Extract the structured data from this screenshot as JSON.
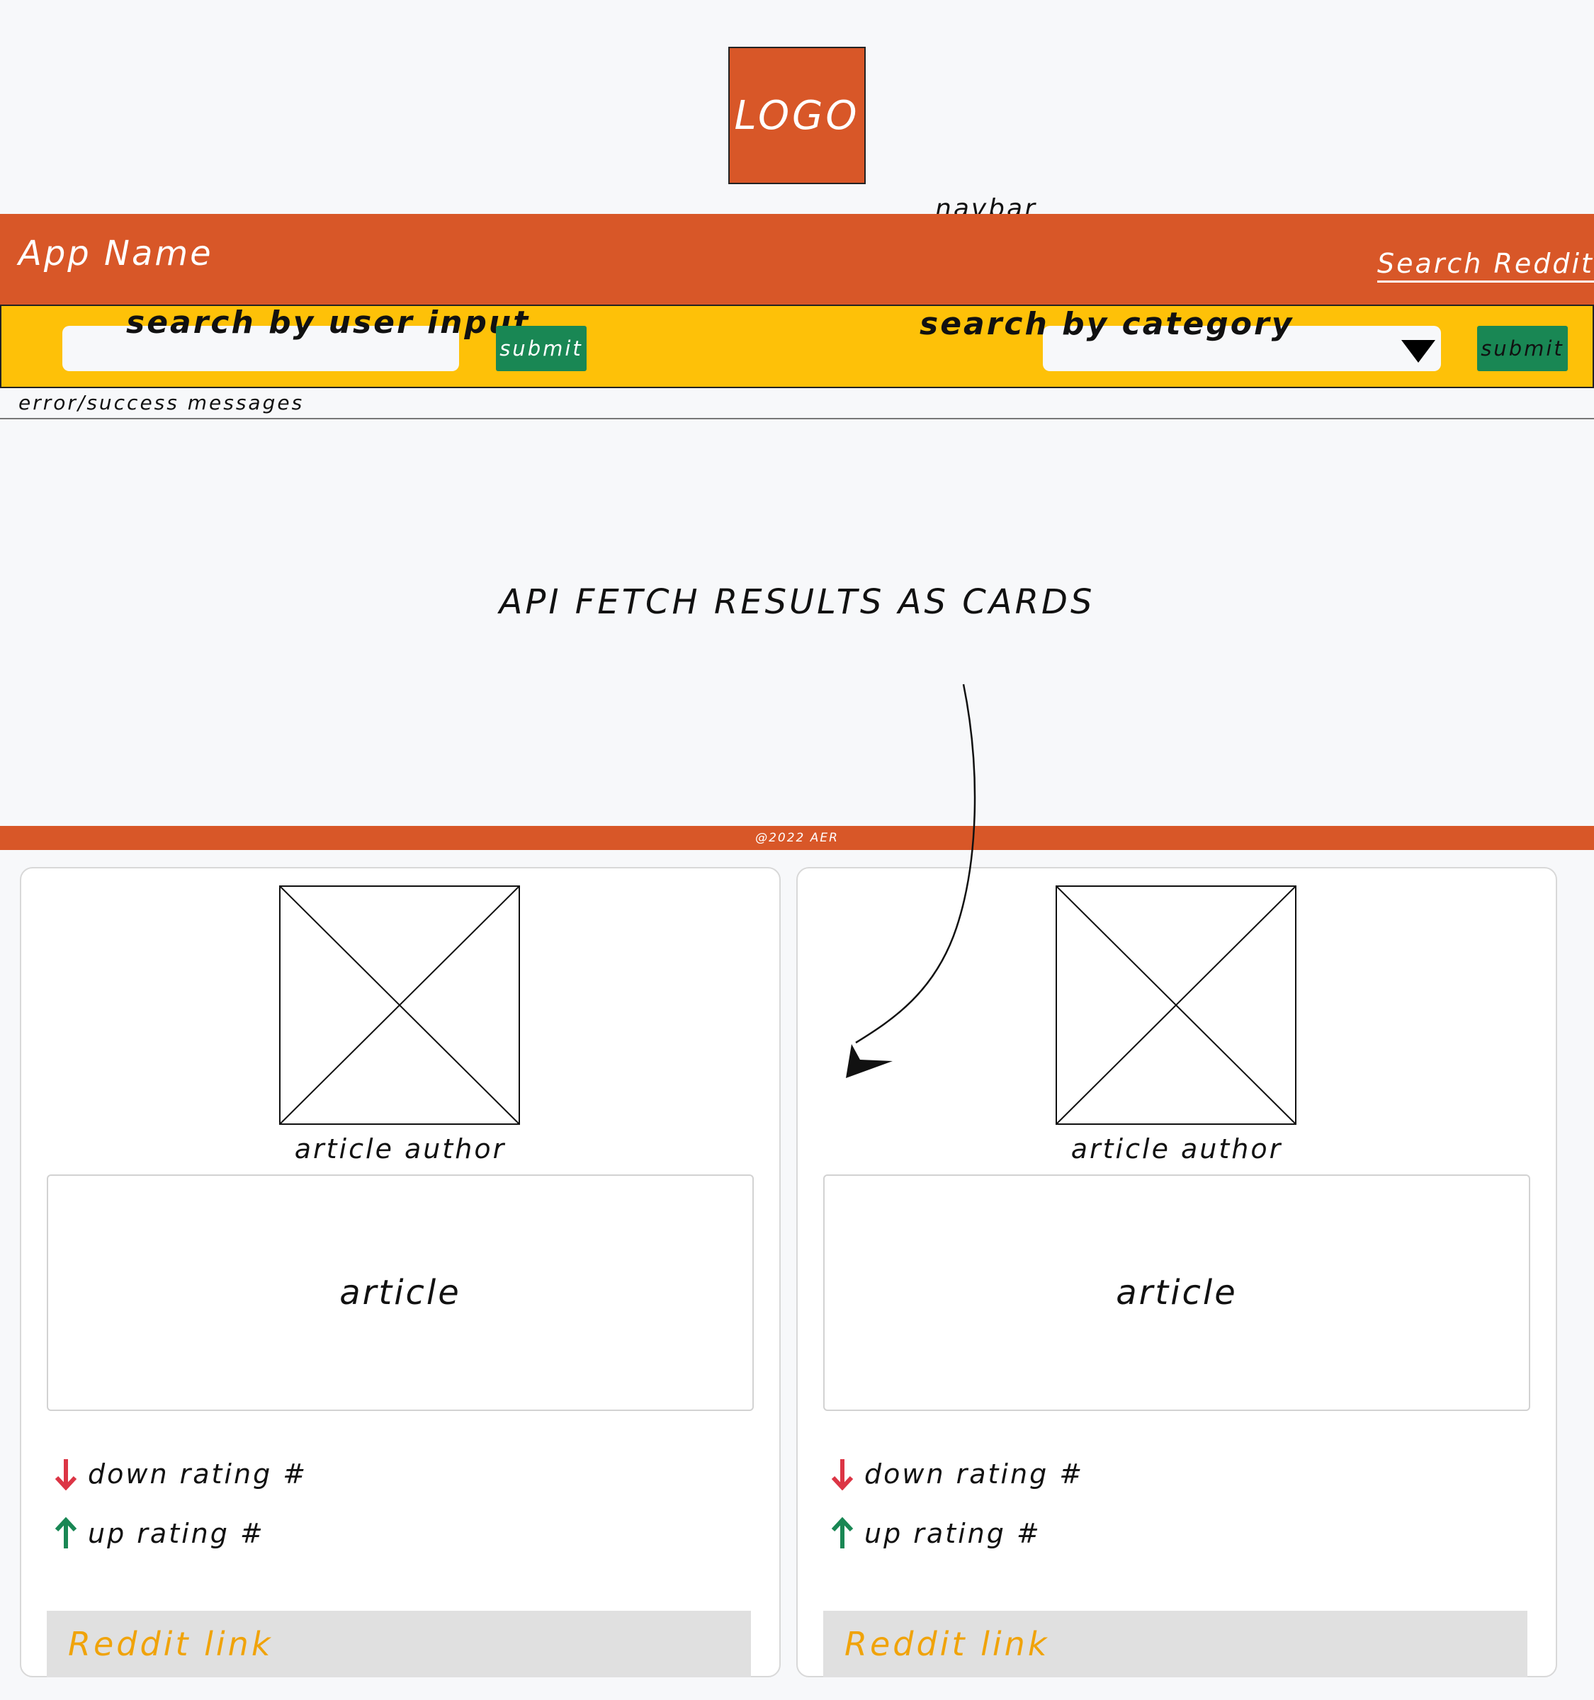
{
  "logo": {
    "text": "LOGO"
  },
  "annotations": {
    "navbar": "navbar",
    "api_results": "API FETCH RESULTS AS CARDS"
  },
  "navbar": {
    "app_name": "App Name",
    "search_reddit": "Search Reddit"
  },
  "search": {
    "user_input_label": "search by user input",
    "user_input_value": "",
    "submit_1": "submit",
    "category_label": "search by category",
    "category_value": "",
    "submit_2": "submit"
  },
  "messages": "error/success messages",
  "footer": "@2022 AER",
  "cards": [
    {
      "author": "article author",
      "article": "article",
      "down_rating": "down rating #",
      "up_rating": "up rating #",
      "link": "Reddit link"
    },
    {
      "author": "article author",
      "article": "article",
      "down_rating": "down rating #",
      "up_rating": "up rating #",
      "link": "Reddit link"
    }
  ],
  "colors": {
    "brand": "#d85728",
    "searchbar": "#fec108",
    "submit": "#198754",
    "down_arrow": "#dc3545",
    "up_arrow": "#198754",
    "link_text": "#f0a30a"
  }
}
